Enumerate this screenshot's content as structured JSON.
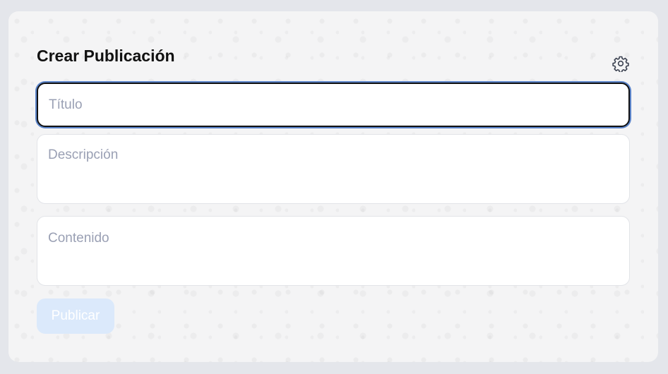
{
  "form": {
    "heading": "Crear Publicación",
    "settings_icon": "gear-icon",
    "title_field": {
      "placeholder": "Título",
      "value": ""
    },
    "description_field": {
      "placeholder": "Descripción",
      "value": ""
    },
    "content_field": {
      "placeholder": "Contenido",
      "value": ""
    },
    "submit_label": "Publicar"
  },
  "colors": {
    "page_background": "#e4e6eb",
    "card_background": "#f4f4f5",
    "focus_ring": "#5b84c9",
    "button_disabled": "#dbe9fb",
    "placeholder_text": "#9aa0b4"
  }
}
